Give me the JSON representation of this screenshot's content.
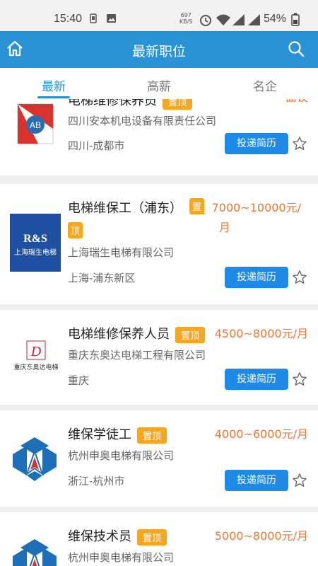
{
  "status_bar": {
    "time": "15:40",
    "net_speed_value": "697",
    "net_speed_unit": "KB/S",
    "battery": "54%"
  },
  "header": {
    "title": "最新职位"
  },
  "tabs": [
    {
      "label": "最新"
    },
    {
      "label": "高薪"
    },
    {
      "label": "名企"
    }
  ],
  "jobs": [
    {
      "title": "电梯维修保养员",
      "badge": "置顶",
      "salary": "面议",
      "company": "四川安本机电设备有限责任公司",
      "location": "四川-成都市",
      "apply_label": "投递简历",
      "logo_text": "AB"
    },
    {
      "title": "电梯维保工（浦东）",
      "badge_part1": "置",
      "badge_part2": "顶",
      "salary_line1": "7000~10000元/",
      "salary_line2": "月",
      "company": "上海瑞生电梯有限公司",
      "location": "上海-浦东新区",
      "apply_label": "投递简历",
      "logo_text": "R&S",
      "logo_subtext": "上海瑞生电梯"
    },
    {
      "title": "电梯维修保养人员",
      "badge": "置顶",
      "salary": "4500~8000元/月",
      "company": "重庆东奥达电梯工程有限公司",
      "location": "重庆",
      "apply_label": "投递简历",
      "logo_text": "D",
      "logo_subtext": "重庆东奥达电梯"
    },
    {
      "title": "维保学徒工",
      "badge": "置顶",
      "salary": "4000~6000元/月",
      "company": "杭州申奥电梯有限公司",
      "location": "浙江-杭州市",
      "apply_label": "投递简历"
    },
    {
      "title": "维保技术员",
      "badge": "置顶",
      "salary": "5000~8000元/月",
      "company": "杭州申奥电梯有限公司"
    }
  ],
  "colors": {
    "primary": "#2a93d5",
    "button": "#1f8ae6",
    "badge": "#f5a623",
    "salary": "#ea7a3a"
  },
  "icons": [
    "home-icon",
    "search-icon",
    "star-icon",
    "wifi-icon",
    "signal-icon",
    "alarm-icon",
    "battery-icon"
  ]
}
